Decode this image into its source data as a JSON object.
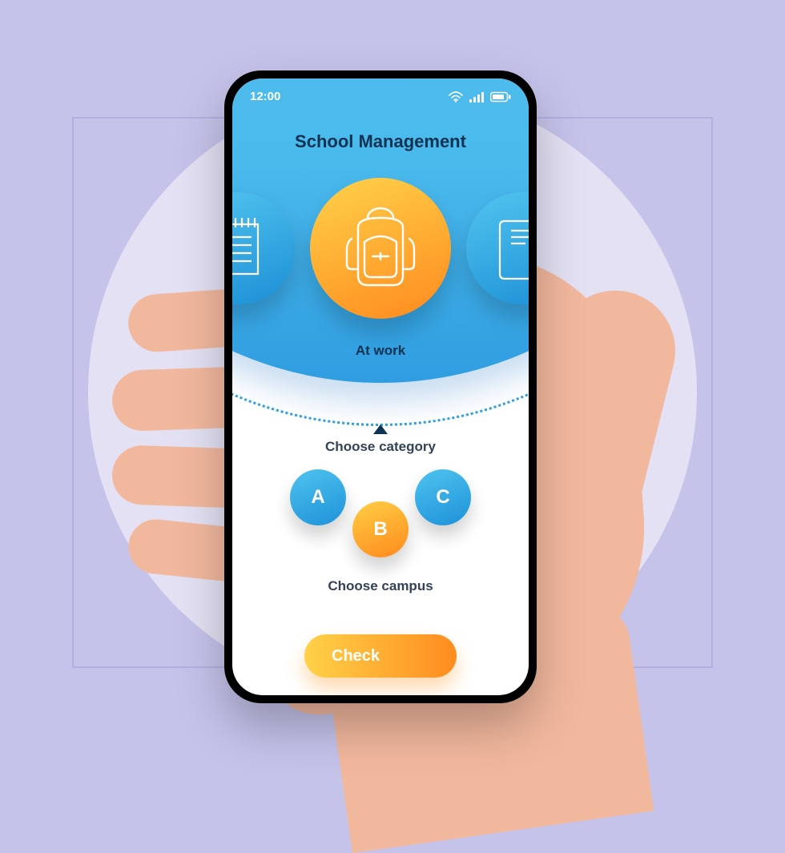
{
  "status": {
    "time": "12:00"
  },
  "header": {
    "title": "School Management"
  },
  "carousel": {
    "left_icon": "notepad-icon",
    "center_icon": "backpack-icon",
    "right_icon": "book-icon",
    "selected_label": "At work"
  },
  "sections": {
    "category_label": "Choose category",
    "campus_label": "Choose campus",
    "campuses": [
      {
        "id": "A",
        "label": "A"
      },
      {
        "id": "B",
        "label": "B"
      },
      {
        "id": "C",
        "label": "C"
      }
    ]
  },
  "actions": {
    "check_label": "Check"
  },
  "colors": {
    "accent_blue": "#2F9DE0",
    "accent_orange": "#FF8C20",
    "bg": "#C5C3EA"
  }
}
